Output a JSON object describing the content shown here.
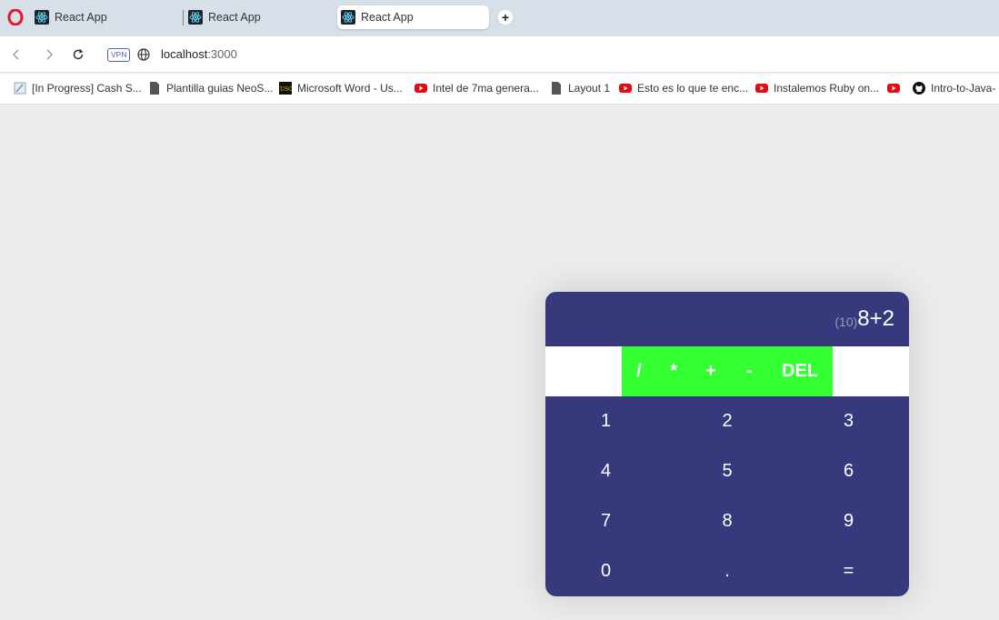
{
  "browser": {
    "tabs": [
      {
        "title": "React App",
        "active": false
      },
      {
        "title": "React App",
        "active": false
      },
      {
        "title": "React App",
        "active": true
      }
    ],
    "new_tab_label": "+",
    "vpn_label": "VPN",
    "url_host": "localhost",
    "url_port": ":3000",
    "bookmarks": [
      {
        "label": "[In Progress] Cash S...",
        "icon": "pencil-doc-icon"
      },
      {
        "label": "Plantilla guias NeoS...",
        "icon": "document-icon"
      },
      {
        "label": "Microsoft Word - Us...",
        "icon": "usc-logo-icon"
      },
      {
        "label": "Intel de 7ma genera...",
        "icon": "youtube-icon"
      },
      {
        "label": "Layout 1",
        "icon": "document-icon"
      },
      {
        "label": "Esto es lo que te enc...",
        "icon": "youtube-icon"
      },
      {
        "label": "Instalemos Ruby on...",
        "icon": "youtube-icon"
      },
      {
        "label": "",
        "icon": "youtube-icon"
      },
      {
        "label": "Intro-to-Java-",
        "icon": "github-icon"
      }
    ]
  },
  "calculator": {
    "result": "(10)",
    "expression": "8+2",
    "operators": [
      "/",
      "*",
      "+",
      "-",
      "DEL"
    ],
    "digits": [
      "1",
      "2",
      "3",
      "4",
      "5",
      "6",
      "7",
      "8",
      "9",
      "0",
      ".",
      "="
    ]
  },
  "colors": {
    "calculator_bg": "#37397d",
    "operator_bg": "#33ff33",
    "page_bg": "#ececec"
  }
}
